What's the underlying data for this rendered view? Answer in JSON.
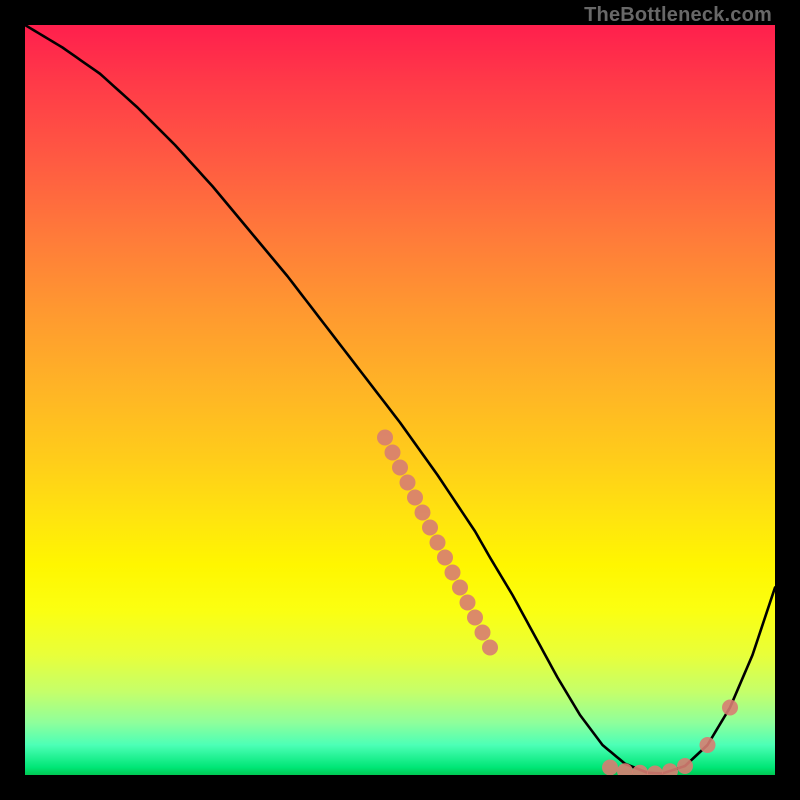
{
  "watermark": "TheBottleneck.com",
  "chart_data": {
    "type": "line",
    "title": "",
    "xlabel": "",
    "ylabel": "",
    "xlim": [
      0,
      100
    ],
    "ylim": [
      0,
      100
    ],
    "series": [
      {
        "name": "curve",
        "x": [
          0,
          5,
          10,
          15,
          20,
          25,
          30,
          35,
          40,
          45,
          50,
          55,
          60,
          62,
          65,
          68,
          71,
          74,
          77,
          80,
          83,
          85,
          88,
          91,
          94,
          97,
          100
        ],
        "values": [
          100,
          97,
          93.5,
          89,
          84,
          78.5,
          72.5,
          66.5,
          60,
          53.5,
          47,
          40,
          32.5,
          29,
          24,
          18.5,
          13,
          8,
          4,
          1.5,
          0.3,
          0.2,
          1.2,
          4,
          9,
          16,
          25
        ]
      }
    ],
    "markers": [
      {
        "x": 48,
        "y": 45
      },
      {
        "x": 49,
        "y": 43
      },
      {
        "x": 50,
        "y": 41
      },
      {
        "x": 51,
        "y": 39
      },
      {
        "x": 52,
        "y": 37
      },
      {
        "x": 53,
        "y": 35
      },
      {
        "x": 54,
        "y": 33
      },
      {
        "x": 55,
        "y": 31
      },
      {
        "x": 56,
        "y": 29
      },
      {
        "x": 57,
        "y": 27
      },
      {
        "x": 58,
        "y": 25
      },
      {
        "x": 59,
        "y": 23
      },
      {
        "x": 60,
        "y": 21
      },
      {
        "x": 61,
        "y": 19
      },
      {
        "x": 62,
        "y": 17
      },
      {
        "x": 78,
        "y": 1
      },
      {
        "x": 80,
        "y": 0.5
      },
      {
        "x": 82,
        "y": 0.3
      },
      {
        "x": 84,
        "y": 0.2
      },
      {
        "x": 86,
        "y": 0.5
      },
      {
        "x": 88,
        "y": 1.2
      },
      {
        "x": 91,
        "y": 4
      },
      {
        "x": 94,
        "y": 9
      }
    ],
    "marker_color": "#d77d72",
    "line_color": "#000000"
  }
}
